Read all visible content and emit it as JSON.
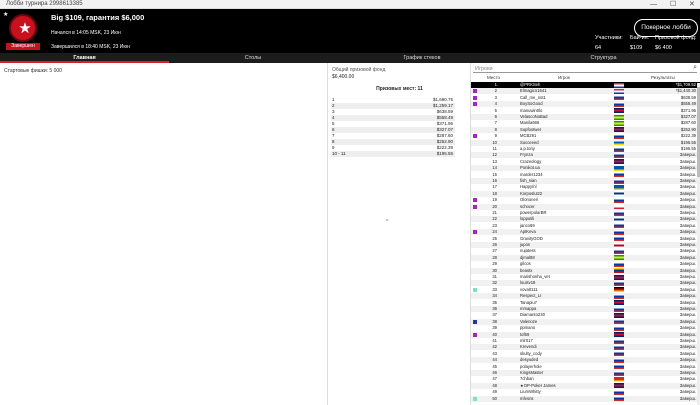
{
  "window": {
    "title": "Лобби турнира 2998613385",
    "minimize": "—",
    "maximize": "☐",
    "close": "✕"
  },
  "logo": {
    "label": "Завершен"
  },
  "header": {
    "title": "Big $109, гарантия $6,000",
    "started": "Начался в 14:05 MSK, 23 Июн",
    "finished": "Завершился в 18:40 MSK, 23 Июн",
    "poker_button": "Покерное лобби"
  },
  "stats": [
    {
      "label": "Участники:",
      "value": "64"
    },
    {
      "label": "Бай-ин:",
      "value": "$109"
    },
    {
      "label": "Призовой фонд:",
      "value": "$6 400"
    }
  ],
  "tabs": [
    {
      "label": "Главная"
    },
    {
      "label": "Столы"
    },
    {
      "label": "График стеков"
    },
    {
      "label": "Структура"
    }
  ],
  "left": {
    "starting_chips": "Стартовые фишки: 5 000"
  },
  "prize": {
    "pool_label": "Общий призовой фонд",
    "pool_value": "$6,400.00",
    "places": "Призовых мест: 11",
    "caret": "^",
    "rows": [
      [
        "1",
        "$1,690.75"
      ],
      [
        "2",
        "$1,259.17"
      ],
      [
        "3",
        "$638.59"
      ],
      [
        "4",
        "$558.49"
      ],
      [
        "5",
        "$371.95"
      ],
      [
        "6",
        "$327.07"
      ],
      [
        "7",
        "$287.60"
      ],
      [
        "8",
        "$252.90"
      ],
      [
        "9",
        "$222.39"
      ],
      [
        "10 - 11",
        "$195.55"
      ]
    ]
  },
  "players": {
    "search_placeholder": "Игроки",
    "search_icon": "search-icon",
    "col_place": "Место",
    "col_player": "Игрок",
    "col_results": "Результаты",
    "rows": [
      {
        "p": "1",
        "n": "@PRKSeh",
        "r": "*$1,709.52",
        "m": "",
        "f": [
          "#d52b1e",
          "#fff",
          "#0039a6"
        ]
      },
      {
        "p": "2",
        "n": "Elmagico1641",
        "r": "*$1,440.30",
        "m": "#a02ab8",
        "f": [
          "#d52b1e",
          "#fff",
          "#0039a6"
        ]
      },
      {
        "p": "3",
        "n": "Call_me_not1",
        "r": "$638.59",
        "m": "#a02ab8",
        "f": [
          "#fff",
          "#0039a6",
          "#d52b1e"
        ]
      },
      {
        "p": "4",
        "n": "BoySoGood",
        "r": "$558.49",
        "m": "#a02ab8",
        "f": [
          "#fff",
          "#0039a6",
          "#d52b1e"
        ]
      },
      {
        "p": "5",
        "n": "manuwin0lo",
        "r": "$371.95",
        "m": "",
        "f": [
          "#012169",
          "#c8102e",
          "#012169"
        ]
      },
      {
        "p": "6",
        "n": "VelascoNoBad",
        "r": "$327.07",
        "m": "",
        "f": [
          "#009c3b",
          "#ffdf00",
          "#009c3b"
        ]
      },
      {
        "p": "7",
        "n": "Manila666",
        "r": "$287.60",
        "m": "",
        "f": [
          "#009c3b",
          "#ffdf00",
          "#009c3b"
        ]
      },
      {
        "p": "8",
        "n": "Supfootwer",
        "r": "$252.90",
        "m": "",
        "f": [
          "#012169",
          "#c8102e",
          "#012169"
        ]
      },
      {
        "p": "9",
        "n": "MCB291",
        "r": "$222.39",
        "m": "#a02ab8",
        "f": [
          "#fff",
          "#0039a6",
          "#d52b1e"
        ]
      },
      {
        "p": "10",
        "n": "Succeeed",
        "r": "$195.55",
        "m": "",
        "f": [
          "#ffffff",
          "#0057b7",
          "#ffd700"
        ]
      },
      {
        "p": "11",
        "n": "a.p.tony",
        "r": "$195.55",
        "m": "",
        "f": [
          "#fff",
          "#0039a6",
          "#d52b1e"
        ]
      },
      {
        "p": "12",
        "n": "Frynza",
        "r": "Заверш.",
        "m": "",
        "f": [
          "#fff",
          "#0039a6",
          "#d52b1e"
        ]
      },
      {
        "p": "13",
        "n": "Crazeology",
        "r": "Заверш.",
        "m": "",
        "f": [
          "#012169",
          "#c8102e",
          "#012169"
        ]
      },
      {
        "p": "14",
        "n": "Ponikot.ua",
        "r": "Заверш.",
        "m": "",
        "f": [
          "#0057b7",
          "#0057b7",
          "#ffd700"
        ]
      },
      {
        "p": "15",
        "n": "marder1234",
        "r": "Заверш.",
        "m": "",
        "f": [
          "#fff",
          "#0039a6",
          "#d52b1e"
        ]
      },
      {
        "p": "16",
        "n": "fish_sian",
        "r": "Заверш.",
        "m": "",
        "f": [
          "#fff",
          "#0039a6",
          "#d52b1e"
        ]
      },
      {
        "p": "17",
        "n": "Happy/nl",
        "r": "Заверш.",
        "m": "",
        "f": [
          "#0057b7",
          "#0057b7",
          "#ffd700"
        ]
      },
      {
        "p": "18",
        "n": "Korposlutz2",
        "r": "Заверш.",
        "m": "",
        "f": [
          "#ffffff",
          "#003580",
          "#ffffff"
        ]
      },
      {
        "p": "19",
        "n": "Olononeri",
        "r": "Заверш.",
        "m": "#a02ab8",
        "f": [
          "#fff",
          "#0039a6",
          "#d52b1e"
        ]
      },
      {
        "p": "20",
        "n": "schocer",
        "r": "Заверш.",
        "m": "#a02ab8",
        "f": [
          "#ffffff",
          "#ffffff",
          "#dc143c"
        ]
      },
      {
        "p": "21",
        "n": "powerpolarBR",
        "r": "Заверш.",
        "m": "",
        "f": [
          "#fff",
          "#0039a6",
          "#d52b1e"
        ]
      },
      {
        "p": "22",
        "n": "lopputili",
        "r": "Заверш.",
        "m": "",
        "f": [
          "#ffffff",
          "#003580",
          "#ffffff"
        ]
      },
      {
        "p": "23",
        "n": "janco69",
        "r": "Заверш.",
        "m": "",
        "f": [
          "#fff",
          "#0039a6",
          "#d52b1e"
        ]
      },
      {
        "p": "24",
        "n": "AptKeva",
        "r": "Заверш.",
        "m": "#a02ab8",
        "f": [
          "#fff",
          "#0039a6",
          "#d52b1e"
        ]
      },
      {
        "p": "25",
        "n": "GravityGOD",
        "r": "Заверш.",
        "m": "",
        "f": [
          "#fff",
          "#0039a6",
          "#d52b1e"
        ]
      },
      {
        "p": "26",
        "n": "jupos",
        "r": "Заверш.",
        "m": "",
        "f": [
          "#ffffff",
          "#bc002d",
          "#ffffff"
        ]
      },
      {
        "p": "27",
        "n": "nujatess",
        "r": "Заверш.",
        "m": "",
        "f": [
          "#fff",
          "#0039a6",
          "#d52b1e"
        ]
      },
      {
        "p": "28",
        "n": "djmal88",
        "r": "Заверш.",
        "m": "",
        "f": [
          "#009c3b",
          "#ffdf00",
          "#009c3b"
        ]
      },
      {
        "p": "29",
        "n": "gilcos",
        "r": "Заверш.",
        "m": "",
        "f": [
          "#fff",
          "#0039a6",
          "#d52b1e"
        ]
      },
      {
        "p": "30",
        "n": "beastx",
        "r": "Заверш.",
        "m": "",
        "f": [
          "#fcd116",
          "#003893",
          "#ce1126"
        ]
      },
      {
        "p": "31",
        "n": "marishonha_vet",
        "r": "Заверш.",
        "m": "",
        "f": [
          "#012169",
          "#c8102e",
          "#012169"
        ]
      },
      {
        "p": "32",
        "n": "louisv18",
        "r": "Заверш.",
        "m": "",
        "f": [
          "#fff",
          "#0039a6",
          "#d52b1e"
        ]
      },
      {
        "p": "33",
        "n": "vova0111",
        "r": "Заверш.",
        "m": "#7fe0c8",
        "f": [
          "#000000",
          "#dd0000",
          "#ffce00"
        ]
      },
      {
        "p": "34",
        "n": "Respect_LI",
        "r": "Заверш.",
        "m": "",
        "f": [
          "#fff",
          "#0039a6",
          "#d52b1e"
        ]
      },
      {
        "p": "35",
        "n": "Tanapiu7",
        "r": "Заверш.",
        "m": "",
        "f": [
          "#012169",
          "#c8102e",
          "#012169"
        ]
      },
      {
        "p": "36",
        "n": "mmappa",
        "r": "Заверш.",
        "m": "",
        "f": [
          "#fff",
          "#0039a6",
          "#d52b1e"
        ]
      },
      {
        "p": "37",
        "n": "Diamanto230",
        "r": "Заверш.",
        "m": "",
        "f": [
          "#012169",
          "#c8102e",
          "#012169"
        ]
      },
      {
        "p": "38",
        "n": "Valenoze",
        "r": "Заверш.",
        "m": "#2a3a8f",
        "f": [
          "#fff",
          "#0039a6",
          "#d52b1e"
        ]
      },
      {
        "p": "39",
        "n": "ppmano",
        "r": "Заверш.",
        "m": "",
        "f": [
          "#fff",
          "#0039a6",
          "#d52b1e"
        ]
      },
      {
        "p": "40",
        "n": "tof69",
        "r": "Заверш.",
        "m": "#a02ab8",
        "f": [
          "#012169",
          "#c8102e",
          "#012169"
        ]
      },
      {
        "p": "41",
        "n": "mlr017",
        "r": "Заверш.",
        "m": "",
        "f": [
          "#fff",
          "#0039a6",
          "#d52b1e"
        ]
      },
      {
        "p": "42",
        "n": "Krevendi",
        "r": "Заверш.",
        "m": "",
        "f": [
          "#fff",
          "#0039a6",
          "#d52b1e"
        ]
      },
      {
        "p": "43",
        "n": "skulty_cody",
        "r": "Заверш.",
        "m": "",
        "f": [
          "#fff",
          "#0039a6",
          "#d52b1e"
        ]
      },
      {
        "p": "44",
        "n": "desyuded",
        "r": "Заверш.",
        "m": "",
        "f": [
          "#fff",
          "#0039a6",
          "#d52b1e"
        ]
      },
      {
        "p": "45",
        "n": "polayerhole",
        "r": "Заверш.",
        "m": "",
        "f": [
          "#fff",
          "#0039a6",
          "#d52b1e"
        ]
      },
      {
        "p": "46",
        "n": "KingsMaster",
        "r": "Заверш.",
        "m": "",
        "f": [
          "#fff",
          "#0039a6",
          "#d52b1e"
        ]
      },
      {
        "p": "47",
        "n": "7chban",
        "r": "Заверш.",
        "m": "",
        "f": [
          "#da251d",
          "#da251d",
          "#ffff00"
        ]
      },
      {
        "p": "48",
        "n": "★OP-Poker James",
        "r": "Заверш.",
        "m": "",
        "f": [
          "#012169",
          "#c8102e",
          "#012169"
        ]
      },
      {
        "p": "49",
        "n": "LiumWhitty",
        "r": "Заверш.",
        "m": "",
        "f": [
          "#fff",
          "#0039a6",
          "#d52b1e"
        ]
      },
      {
        "p": "50",
        "n": "mfesns",
        "r": "Заверш.",
        "m": "#7fe0c8",
        "f": [
          "#fff",
          "#0039a6",
          "#d52b1e"
        ]
      }
    ]
  }
}
